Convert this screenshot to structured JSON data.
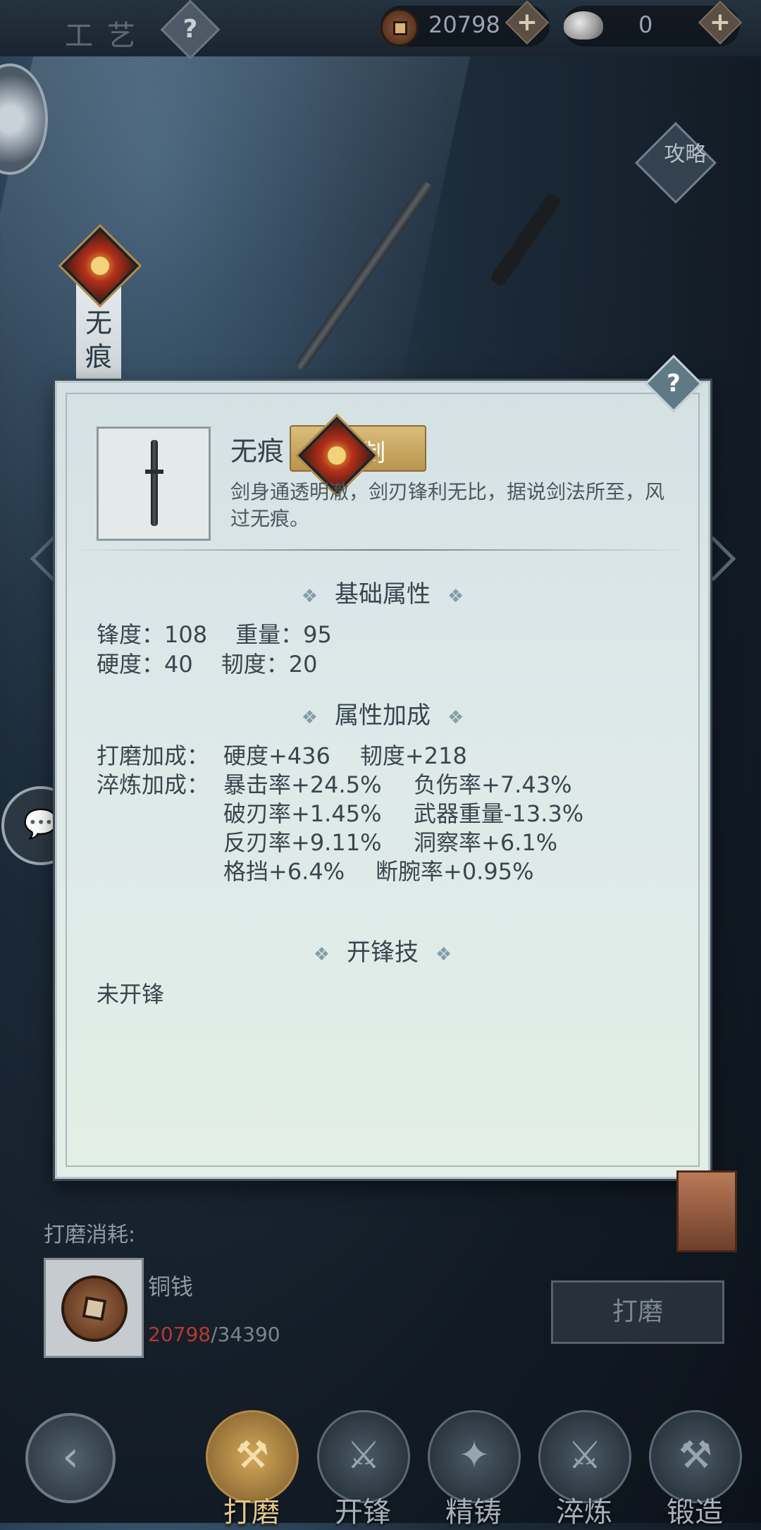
{
  "topbar": {
    "title": "工艺",
    "help": "?",
    "copper_value": "20798",
    "silver_value": "0",
    "plus": "+"
  },
  "side": {
    "strategy_label": "攻略",
    "weapon_tag": "无痕"
  },
  "panel": {
    "help": "?",
    "item_name": "无痕",
    "restrain_label": "克制",
    "description": "剑身通透明澈，剑刃锋利无比，据说剑法所至，风过无痕。",
    "section_base": "基础属性",
    "base_stats": {
      "line1_a": "锋度：108",
      "line1_b": "重量：95",
      "line2_a": "硬度：40",
      "line2_b": "韧度：20"
    },
    "section_bonus": "属性加成",
    "grind_label": "打磨加成：",
    "grind_values": [
      "硬度+436",
      "韧度+218"
    ],
    "temper_label": "淬炼加成：",
    "temper_rows": [
      [
        "暴击率+24.5%",
        "负伤率+7.43%"
      ],
      [
        "破刃率+1.45%",
        "武器重量-13.3%"
      ],
      [
        "反刃率+9.11%",
        "洞察率+6.1%"
      ],
      [
        "格挡+6.4%",
        "断腕率+0.95%"
      ]
    ],
    "section_skill": "开锋技",
    "skill_value": "未开锋",
    "ornament": "❖"
  },
  "consume": {
    "label": "打磨消耗:",
    "item_name": "铜钱",
    "have": "20798",
    "need": "/34390",
    "button": "打磨"
  },
  "nav": {
    "back": "‹",
    "items": [
      {
        "label": "打磨",
        "icon": "⚒"
      },
      {
        "label": "开锋",
        "icon": "⚔"
      },
      {
        "label": "精铸",
        "icon": "✦"
      },
      {
        "label": "淬炼",
        "icon": "⚔"
      },
      {
        "label": "锻造",
        "icon": "⚒"
      }
    ]
  },
  "chat_icon": "💬"
}
